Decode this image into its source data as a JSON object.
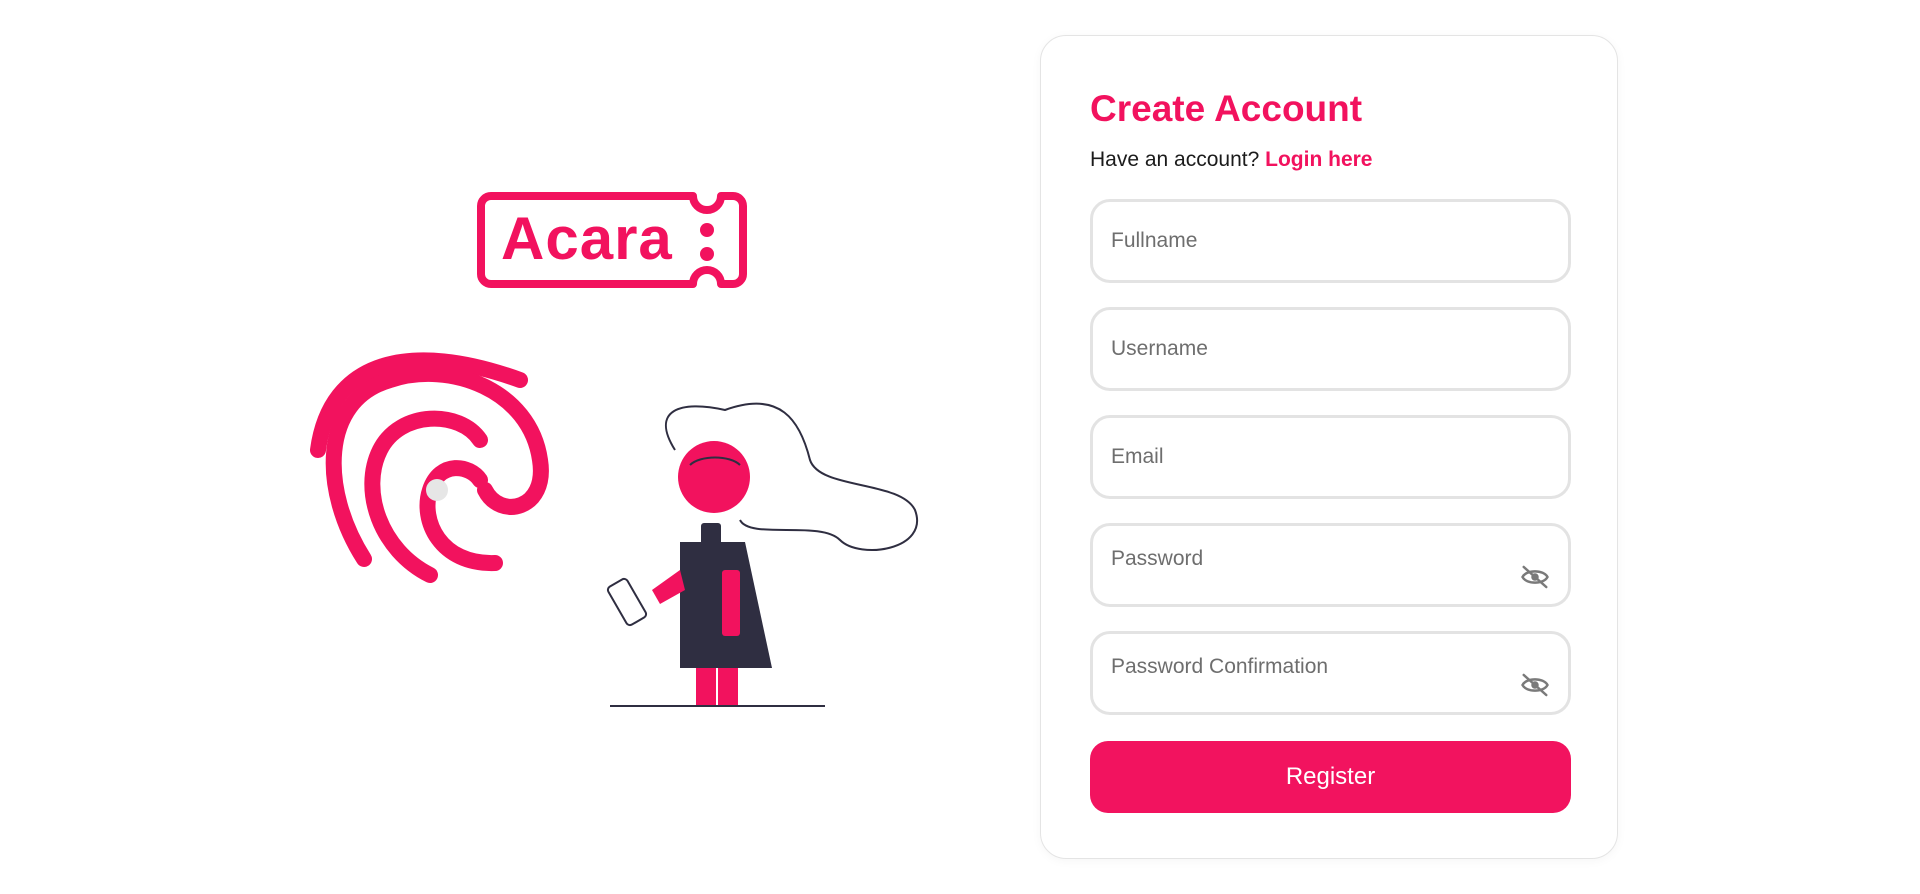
{
  "brand": {
    "logo_text": "Acara",
    "accent_color": "#f2125e"
  },
  "illustration": {
    "icon": "fingerprint-icon",
    "figure": "person-holding-phone"
  },
  "form": {
    "title": "Create Account",
    "subtitle_prefix": "Have an account?",
    "login_link": "Login here",
    "fields": [
      {
        "name": "fullname",
        "placeholder": "Fullname",
        "value": ""
      },
      {
        "name": "username",
        "placeholder": "Username",
        "value": ""
      },
      {
        "name": "email",
        "placeholder": "Email",
        "value": ""
      },
      {
        "name": "password",
        "placeholder": "Password",
        "value": "",
        "icon": "eye-off-icon"
      },
      {
        "name": "password_confirmation",
        "placeholder": "Password Confirmation",
        "value": "",
        "icon": "eye-off-icon"
      }
    ],
    "submit_label": "Register"
  }
}
